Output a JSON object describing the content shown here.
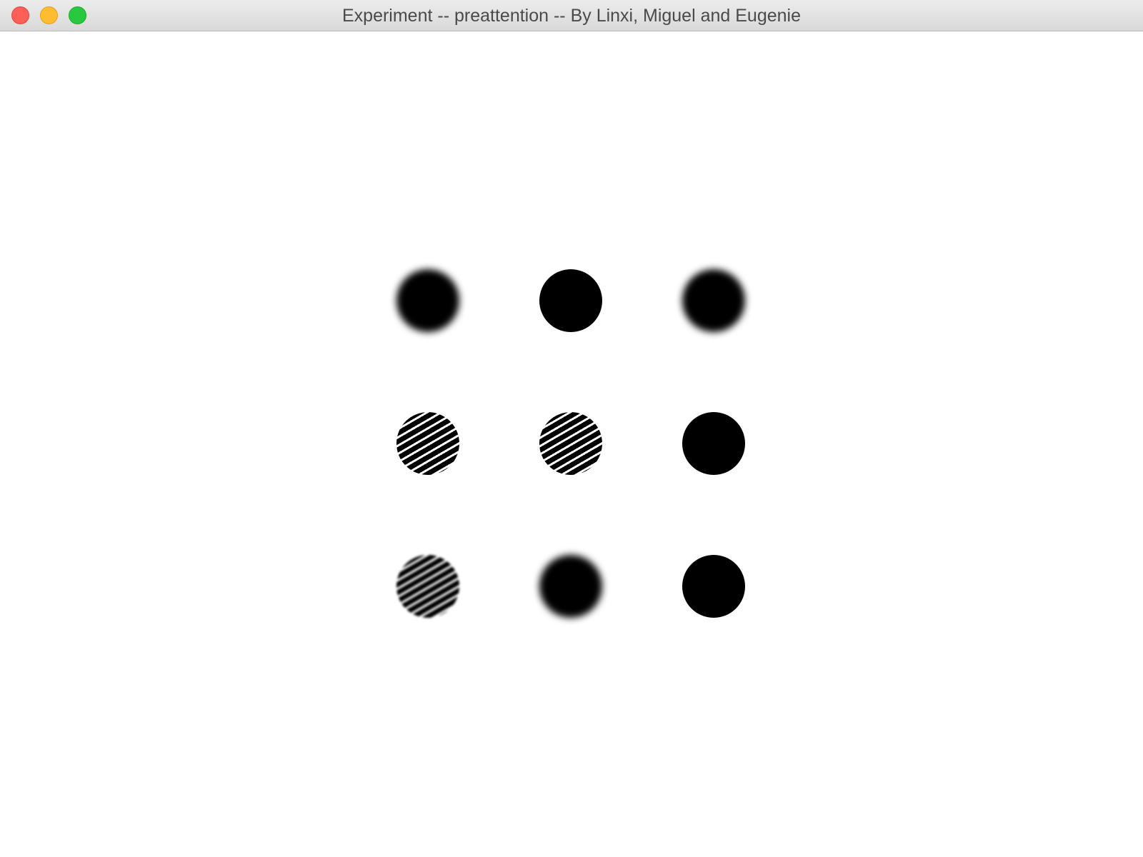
{
  "window": {
    "title": "Experiment -- preattention -- By Linxi, Miguel and Eugenie",
    "controls": [
      {
        "name": "close",
        "color": "#fe5f57"
      },
      {
        "name": "minimize",
        "color": "#febc2e"
      },
      {
        "name": "maximize",
        "color": "#28c840"
      }
    ]
  },
  "stimuli": {
    "rows": 3,
    "columns": 3,
    "color": "#000000",
    "items": [
      {
        "row": 1,
        "col": 1,
        "shape": "circle",
        "fill": "solid",
        "blurred": true
      },
      {
        "row": 1,
        "col": 2,
        "shape": "circle",
        "fill": "solid",
        "blurred": false
      },
      {
        "row": 1,
        "col": 3,
        "shape": "circle",
        "fill": "solid",
        "blurred": true
      },
      {
        "row": 2,
        "col": 1,
        "shape": "circle",
        "fill": "striped",
        "blurred": false
      },
      {
        "row": 2,
        "col": 2,
        "shape": "circle",
        "fill": "striped",
        "blurred": false
      },
      {
        "row": 2,
        "col": 3,
        "shape": "circle",
        "fill": "solid",
        "blurred": false
      },
      {
        "row": 3,
        "col": 1,
        "shape": "circle",
        "fill": "striped",
        "blurred": true
      },
      {
        "row": 3,
        "col": 2,
        "shape": "circle",
        "fill": "solid",
        "blurred": true
      },
      {
        "row": 3,
        "col": 3,
        "shape": "circle",
        "fill": "solid",
        "blurred": false
      }
    ]
  }
}
